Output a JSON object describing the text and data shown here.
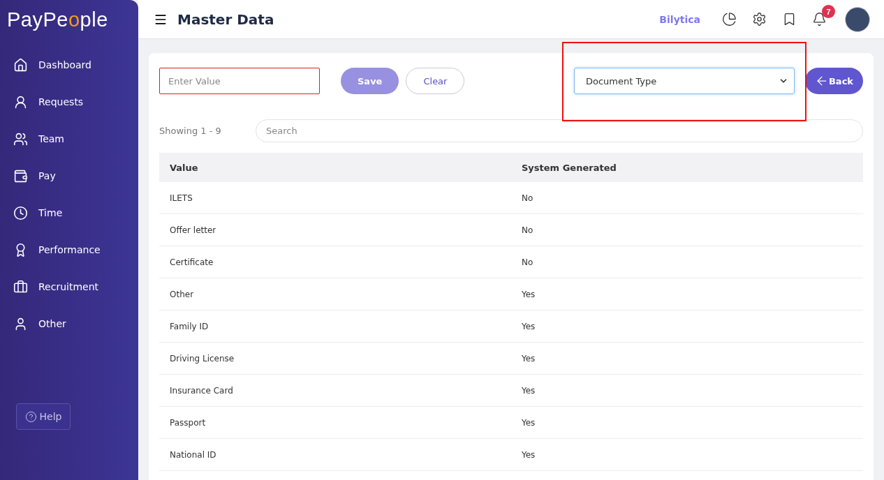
{
  "logo": {
    "before": "PayPe",
    "ring": "o",
    "after": "ple"
  },
  "sidebar": {
    "items": [
      {
        "label": "Dashboard",
        "kind": "home",
        "selected": false
      },
      {
        "label": "Requests",
        "kind": "requests",
        "selected": false
      },
      {
        "label": "Team",
        "kind": "team",
        "selected": false
      },
      {
        "label": "Pay",
        "kind": "pay",
        "selected": false
      },
      {
        "label": "Time",
        "kind": "time",
        "selected": false
      },
      {
        "label": "Performance",
        "kind": "performance",
        "selected": false
      },
      {
        "label": "Recruitment",
        "kind": "recruitment",
        "selected": false
      },
      {
        "label": "Other",
        "kind": "other",
        "selected": false
      }
    ],
    "help": "Help"
  },
  "header": {
    "title": "Master Data",
    "company": "Bilytica",
    "notifications": "7"
  },
  "form": {
    "value_placeholder": "Enter Value",
    "save": "Save",
    "clear": "Clear",
    "type_select": "Document Type",
    "back": "Back"
  },
  "showing": "Showing 1 - 9",
  "search": {
    "placeholder": "Search"
  },
  "table": {
    "columns": [
      "Value",
      "System Generated"
    ],
    "rows": [
      [
        "ILETS",
        "No"
      ],
      [
        "Offer letter",
        "No"
      ],
      [
        "Certificate",
        "No"
      ],
      [
        "Other",
        "Yes"
      ],
      [
        "Family ID",
        "Yes"
      ],
      [
        "Driving License",
        "Yes"
      ],
      [
        "Insurance Card",
        "Yes"
      ],
      [
        "Passport",
        "Yes"
      ],
      [
        "National ID",
        "Yes"
      ]
    ]
  }
}
